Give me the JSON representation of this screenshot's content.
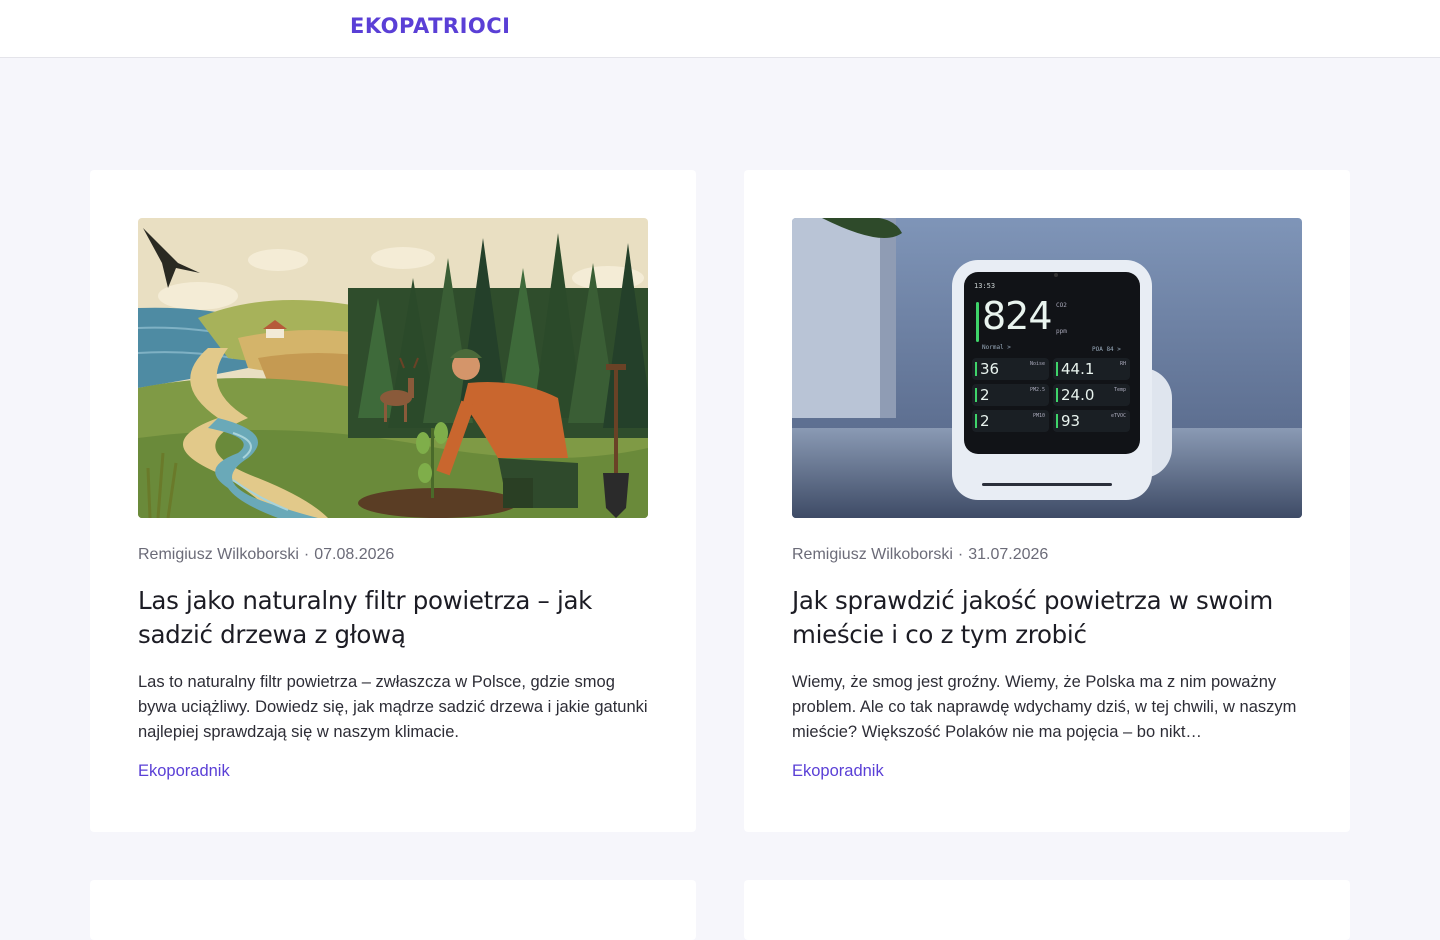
{
  "header": {
    "logo": "EKOPATRIOCI"
  },
  "colors": {
    "accent": "#5a3fd6",
    "page_bg": "#f6f6fb",
    "card_bg": "#ffffff"
  },
  "posts": [
    {
      "author": "Remigiusz Wilkoborski",
      "separator": "·",
      "date": "07.08.2026",
      "title": "Las jako naturalny filtr powietrza – jak sadzić drzewa z głową",
      "excerpt": "Las to naturalny filtr powietrza – zwłaszcza w Polsce, gdzie smog bywa uciążliwy. Dowiedz się, jak mądrze sadzić drzewa i jakie gatunki najlepiej sprawdzają się w naszym klimacie.",
      "category": "Ekoporadnik",
      "image": "illustration-man-planting-tree-in-forest"
    },
    {
      "author": "Remigiusz Wilkoborski",
      "separator": "·",
      "date": "31.07.2026",
      "title": "Jak sprawdzić jakość powietrza w swoim mieście i co z tym zrobić",
      "excerpt": "Wiemy, że smog jest groźny. Wiemy, że Polska ma z nim poważny problem. Ale co tak naprawdę wdychamy dziś, w tej chwili, w naszym mieście? Większość Polaków nie ma pojęcia – bo nikt…",
      "category": "Ekoporadnik",
      "image": "photo-air-quality-monitor",
      "monitor": {
        "time": "13:53",
        "co2_value": "824",
        "co2_label": "CO2",
        "co2_unit": "ppm",
        "status": "Normal >",
        "poa": "POA 84 >",
        "readings": [
          {
            "label": "Noise",
            "value": "36"
          },
          {
            "label": "RH",
            "value": "44.1"
          },
          {
            "label": "PM2.5",
            "value": "2"
          },
          {
            "label": "Temp",
            "value": "24.0"
          },
          {
            "label": "PM10",
            "value": "2"
          },
          {
            "label": "eTVOC",
            "value": "93"
          }
        ]
      }
    }
  ]
}
